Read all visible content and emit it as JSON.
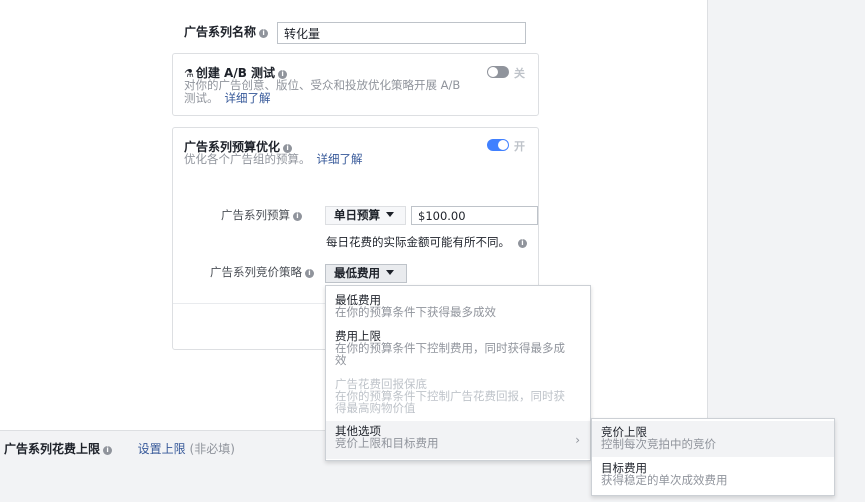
{
  "campaign_name": {
    "label": "广告系列名称",
    "value": "转化量"
  },
  "ab_test": {
    "title": "创建 A/B 测试",
    "description": "对你的广告创意、版位、受众和投放优化策略开展 A/B 测试。",
    "learn_more": "详细了解",
    "toggle_text": "关",
    "enabled": false
  },
  "budget_optimization": {
    "title": "广告系列预算优化",
    "description": "优化各个广告组的预算。",
    "learn_more": "详细了解",
    "toggle_text": "开",
    "enabled": true,
    "budget_label": "广告系列预算",
    "budget_type": "单日预算",
    "budget_amount": "$100.00",
    "budget_note": "每日花费的实际金额可能有所不同。",
    "bid_label": "广告系列竞价策略",
    "bid_selected": "最低费用"
  },
  "bid_menu": {
    "items": [
      {
        "title": "最低费用",
        "subtitle": "在你的预算条件下获得最多成效",
        "disabled": false
      },
      {
        "title": "费用上限",
        "subtitle": "在你的预算条件下控制费用，同时获得最多成效",
        "disabled": false
      },
      {
        "title": "广告花费回报保底",
        "subtitle": "在你的预算条件下控制广告花费回报，同时获得最高购物价值",
        "disabled": true
      },
      {
        "title": "其他选项",
        "subtitle": "竞价上限和目标费用",
        "disabled": false,
        "has_submenu": true
      }
    ]
  },
  "bid_submenu": {
    "items": [
      {
        "title": "竞价上限",
        "subtitle": "控制每次竞拍中的竞价"
      },
      {
        "title": "目标费用",
        "subtitle": "获得稳定的单次成效费用"
      }
    ]
  },
  "spend_limit": {
    "label": "广告系列花费上限",
    "link": "设置上限",
    "optional": "(非必填)"
  }
}
